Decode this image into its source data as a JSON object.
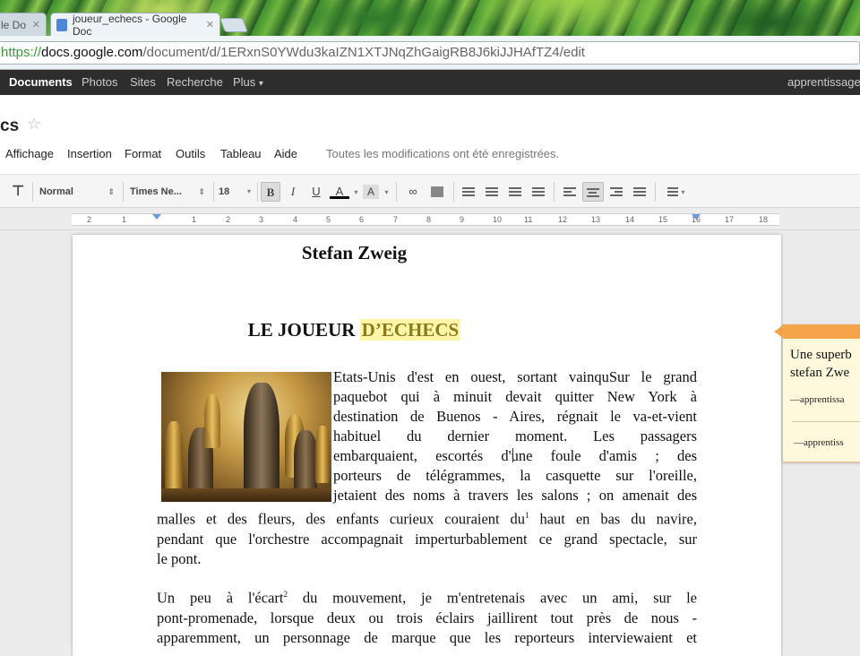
{
  "browser": {
    "tabs": [
      {
        "label": "le Do",
        "active": false
      },
      {
        "label": "joueur_echecs - Google Doc",
        "active": true
      }
    ],
    "url": {
      "scheme": "https://",
      "host": "docs.google.com",
      "path": "/document/d/1ERxnS0YWdu3kaIZN1XTJNqZhGaigRB8J6kiJJHAfTZ4/edit"
    }
  },
  "gbar": {
    "items": [
      "Documents",
      "Photos",
      "Sites",
      "Recherche",
      "Plus"
    ],
    "plus_arrow": "▾",
    "account": "apprentissage"
  },
  "doc": {
    "title": "cs",
    "star": "☆",
    "menus": [
      "Affichage",
      "Insertion",
      "Format",
      "Outils",
      "Tableau",
      "Aide"
    ],
    "save_status": "Toutes les modifications ont été enregistrées."
  },
  "toolbar": {
    "style": "Normal",
    "font": "Times Ne...",
    "size": "18",
    "bold": "B",
    "italic": "I",
    "underline": "U",
    "text_color": "A",
    "highlight": "A"
  },
  "ruler": {
    "numbers": [
      "2",
      "1",
      "1",
      "2",
      "3",
      "4",
      "5",
      "6",
      "7",
      "8",
      "9",
      "10",
      "11",
      "12",
      "13",
      "14",
      "15",
      "16",
      "17",
      "18"
    ]
  },
  "content": {
    "author": "Stefan Zweig",
    "title_plain": "LE JOUEUR ",
    "title_highlight": "D’ECHECS",
    "paragraph1_wrapped": [
      "Etats-Unis d'est en ouest, sortant vainquSur le grand",
      "paquebot  qui à minuit devait  quitter New York à",
      "destination de Buenos - Aires, régnait le va-et-vient",
      "habituel  du  dernier  moment.  Les  passagers",
      "embarquaient,  escortés d'une foule d'amis ; des",
      "porteurs de télégrammes, la casquette sur l'oreille,",
      "jetaient des noms à travers les salons ; on amenait des"
    ],
    "paragraph1_full_a": "malles et des fleurs, des enfants curieux couraient du",
    "footnote1": "1",
    "paragraph1_full_b": " haut en bas du navire,",
    "paragraph1_full_lines": [
      "pendant que l'orchestre accompagnait imperturbablement ce grand spectacle, sur",
      "le pont."
    ],
    "paragraph2_a": "Un peu à l'écart",
    "footnote2": "2",
    "paragraph2_b": " du mouvement, je m'entretenais avec un ami, sur le",
    "paragraph2_lines": [
      "pont-promenade, lorsque deux ou trois éclairs jaillirent tout près de nous -",
      "apparemment, un personnage de marque que les reporteurs interviewaient et"
    ]
  },
  "comment": {
    "text_lines": [
      "Une superb",
      "stefan Zwe"
    ],
    "author_lines": [
      "—apprentissa",
      "—apprentiss"
    ]
  }
}
